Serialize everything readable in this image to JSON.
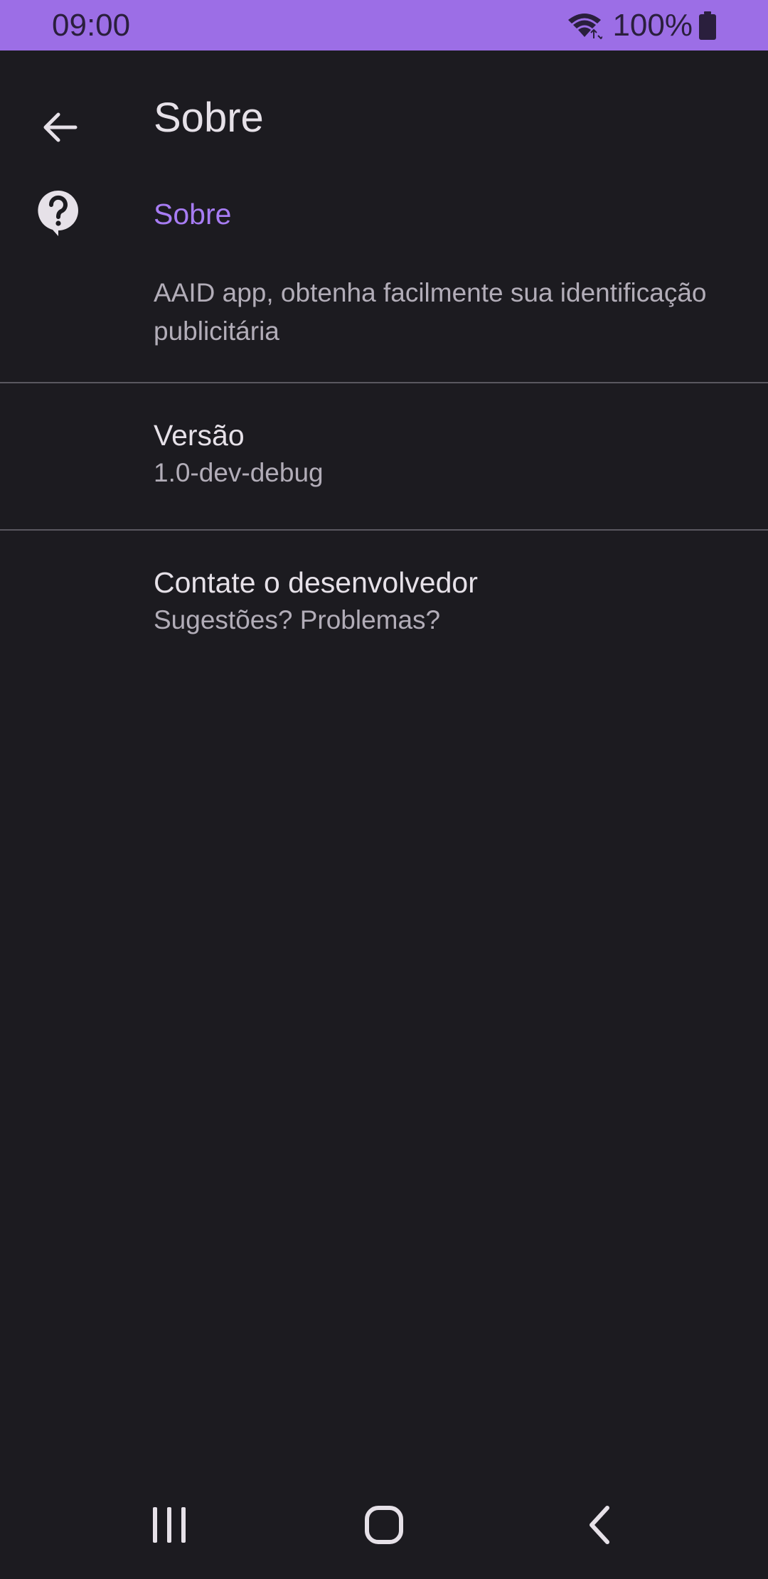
{
  "status_bar": {
    "time": "09:00",
    "battery": "100%",
    "wifi_icon": "wifi-icon",
    "battery_icon": "battery-icon",
    "background_color": "#9c6ee6"
  },
  "app_bar": {
    "title": "Sobre",
    "back_icon": "arrow-back-icon"
  },
  "about_section": {
    "icon": "help-icon",
    "title": "Sobre",
    "description": "AAID app, obtenha facilmente sua identificação publicitária",
    "accent_color": "#a77cf3"
  },
  "preferences": [
    {
      "title": "Versão",
      "summary": "1.0-dev-debug"
    },
    {
      "title": "Contate o desenvolvedor",
      "summary": "Sugestões? Problemas?"
    }
  ],
  "nav_bar": {
    "recents_icon": "recents-icon",
    "home_icon": "home-icon",
    "back_icon": "back-icon"
  },
  "theme": {
    "background": "#1c1b20",
    "text_primary": "#e6e1e8",
    "text_secondary": "#b2adb8"
  }
}
